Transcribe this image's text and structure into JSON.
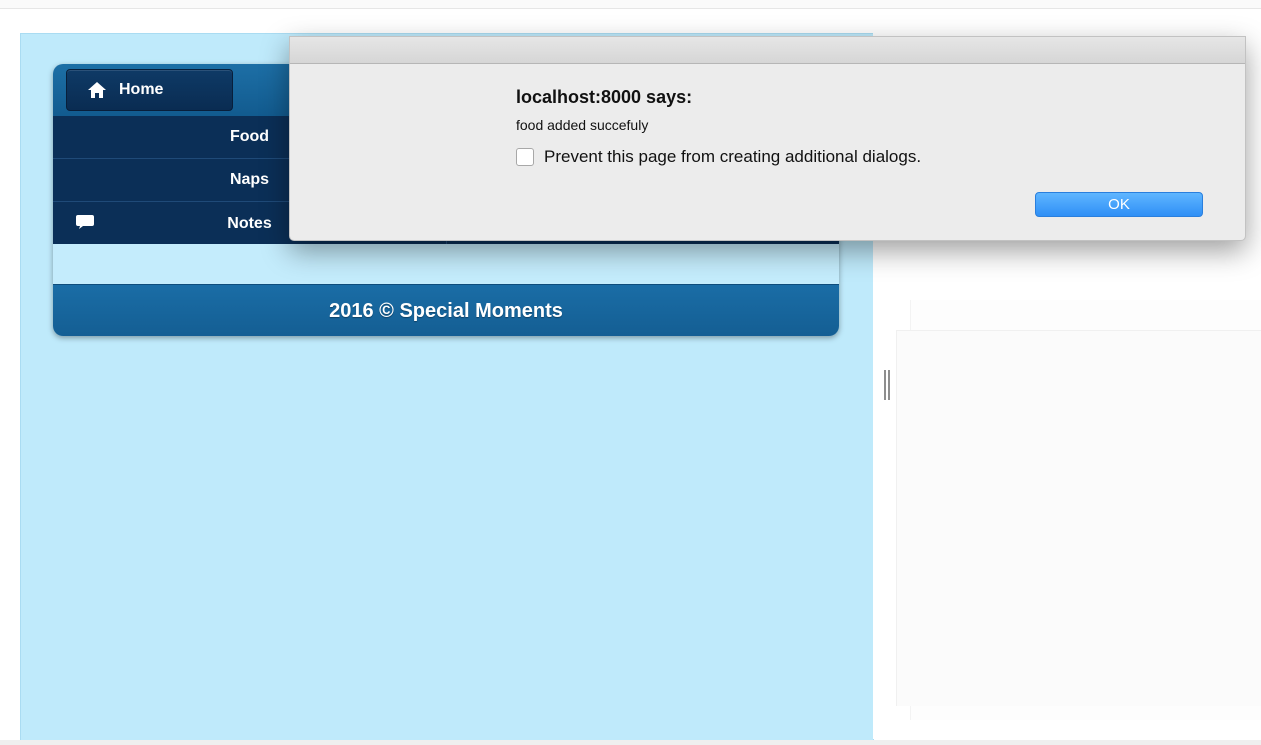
{
  "app": {
    "home_label": "Home",
    "nav": [
      {
        "label": "Food"
      },
      {
        "label": "Naps"
      },
      {
        "label": "Notes"
      }
    ],
    "footer_text": "2016 © Special Moments"
  },
  "dialog": {
    "heading": "localhost:8000 says:",
    "message": "food added succefuly",
    "checkbox_label": "Prevent this page from creating additional dialogs.",
    "ok_label": "OK"
  },
  "colors": {
    "page_background": "#bfeafb",
    "nav_dark": "#0b2f57",
    "header_blue": "#1d6fa6",
    "ok_blue": "#2f8ff6"
  },
  "icons": {
    "home": "home-icon",
    "note": "speech-bubble-icon"
  }
}
